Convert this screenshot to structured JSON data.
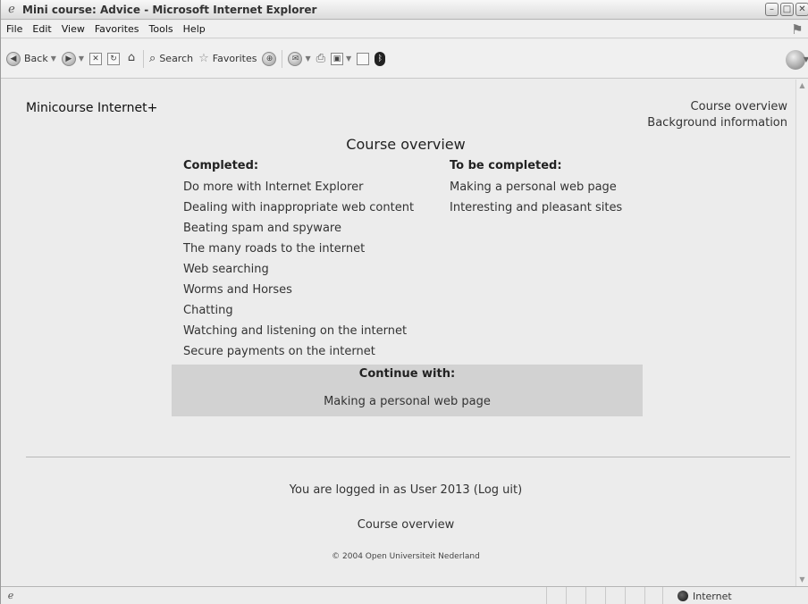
{
  "window": {
    "title": "Mini course: Advice - Microsoft Internet Explorer",
    "controls": [
      "minimize",
      "maximize",
      "close"
    ]
  },
  "menu": [
    "File",
    "Edit",
    "View",
    "Favorites",
    "Tools",
    "Help"
  ],
  "toolbar": {
    "back_label": "Back",
    "search_label": "Search",
    "favorites_label": "Favorites"
  },
  "page": {
    "site_title": "Minicourse Internet+",
    "top_links": [
      "Course overview",
      "Background information"
    ],
    "heading": "Course overview",
    "completed": {
      "header": "Completed:",
      "items": [
        "Do more with Internet Explorer",
        "Dealing with inappropriate web content",
        "Beating spam and spyware",
        "The many roads to the internet",
        "Web searching",
        "Worms and Horses",
        "Chatting",
        "Watching and listening on the internet",
        "Secure payments on the internet"
      ]
    },
    "to_be_completed": {
      "header": "To be completed:",
      "items": [
        "Making a personal web page",
        "Interesting and pleasant sites"
      ]
    },
    "continue": {
      "label": "Continue with:",
      "link": "Making a personal web page"
    },
    "footer": {
      "login_text": "You are logged in as User 2013 (Log uit)",
      "course_link": "Course overview",
      "copyright": "© 2004 Open Universiteit Nederland"
    }
  },
  "status": {
    "zone": "Internet"
  }
}
